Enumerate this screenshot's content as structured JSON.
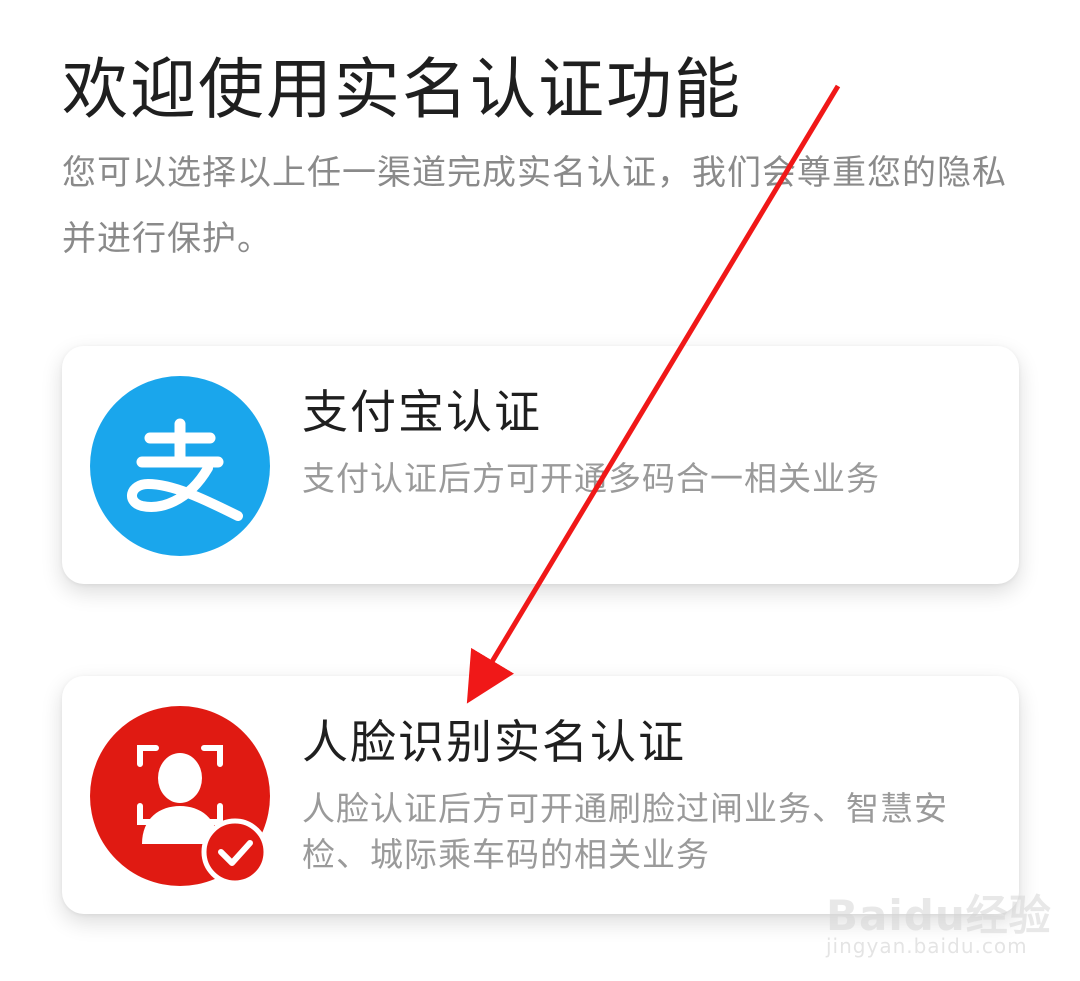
{
  "header": {
    "title": "欢迎使用实名认证功能",
    "subtitle": "您可以选择以上任一渠道完成实名认证，我们会尊重您的隐私并进行保护。"
  },
  "options": [
    {
      "title": "支付宝认证",
      "description": "支付认证后方可开通多码合一相关业务",
      "icon": "alipay-icon",
      "icon_color": "#1aa6ec"
    },
    {
      "title": "人脸识别实名认证",
      "description": "人脸认证后方可开通刷脸过闸业务、智慧安检、城际乘车码的相关业务",
      "icon": "face-recognition-icon",
      "icon_color": "#e01a12"
    }
  ],
  "annotation": {
    "arrow_color": "#f01818"
  },
  "watermark": {
    "brand": "Baidu经验",
    "url": "jingyan.baidu.com"
  }
}
